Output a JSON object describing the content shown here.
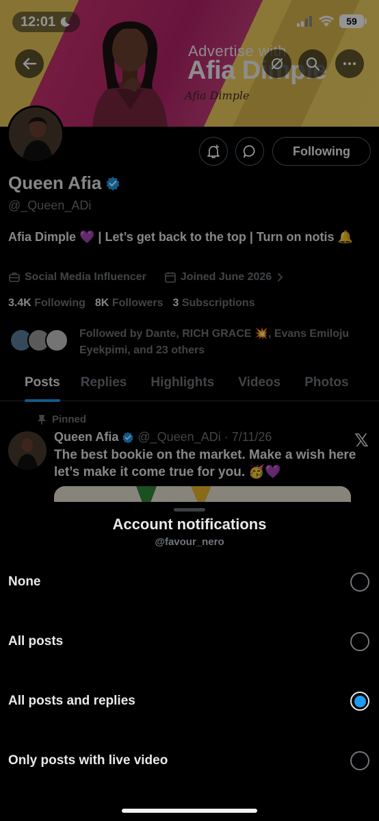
{
  "status_bar": {
    "time": "12:01",
    "battery": "59"
  },
  "banner": {
    "advertise": "Advertise with",
    "name": "Afia Dimple",
    "signature": "Afia Dimple"
  },
  "profile": {
    "display_name": "Queen Afia",
    "handle": "@_Queen_ADi",
    "bio": "Afia Dimple 💜 | Let’s get back to the top | Turn on notis 🔔",
    "category": "Social Media Influencer",
    "joined": "Joined June 2026",
    "following_button": "Following",
    "stats": [
      {
        "value": "3.4K",
        "label": "Following"
      },
      {
        "value": "8K",
        "label": "Followers"
      },
      {
        "value": "3",
        "label": "Subscriptions"
      }
    ],
    "followed_by": "Followed by Dante, RICH GRACE 💥, Evans Emiloju Eyekpimi, and 23 others"
  },
  "tabs": [
    {
      "label": "Posts",
      "active": true
    },
    {
      "label": "Replies",
      "active": false
    },
    {
      "label": "Highlights",
      "active": false
    },
    {
      "label": "Videos",
      "active": false
    },
    {
      "label": "Photos",
      "active": false
    }
  ],
  "pinned_post": {
    "pinned_label": "Pinned",
    "author": "Queen Afia",
    "meta": "@_Queen_ADi · 7/11/26",
    "text": "The best bookie on the market. Make a wish here let’s make it come true for you. 🥳💜",
    "x_mark": "𝕏"
  },
  "sheet": {
    "title": "Account notifications",
    "subtitle": "@favour_nero",
    "options": [
      {
        "label": "None",
        "selected": false
      },
      {
        "label": "All posts",
        "selected": false
      },
      {
        "label": "All posts and replies",
        "selected": true
      },
      {
        "label": "Only posts with live video",
        "selected": false
      }
    ]
  },
  "colors": {
    "accent": "#1d9bf0",
    "muted": "#71767b",
    "text": "#e7e9ea",
    "background": "#000000"
  }
}
